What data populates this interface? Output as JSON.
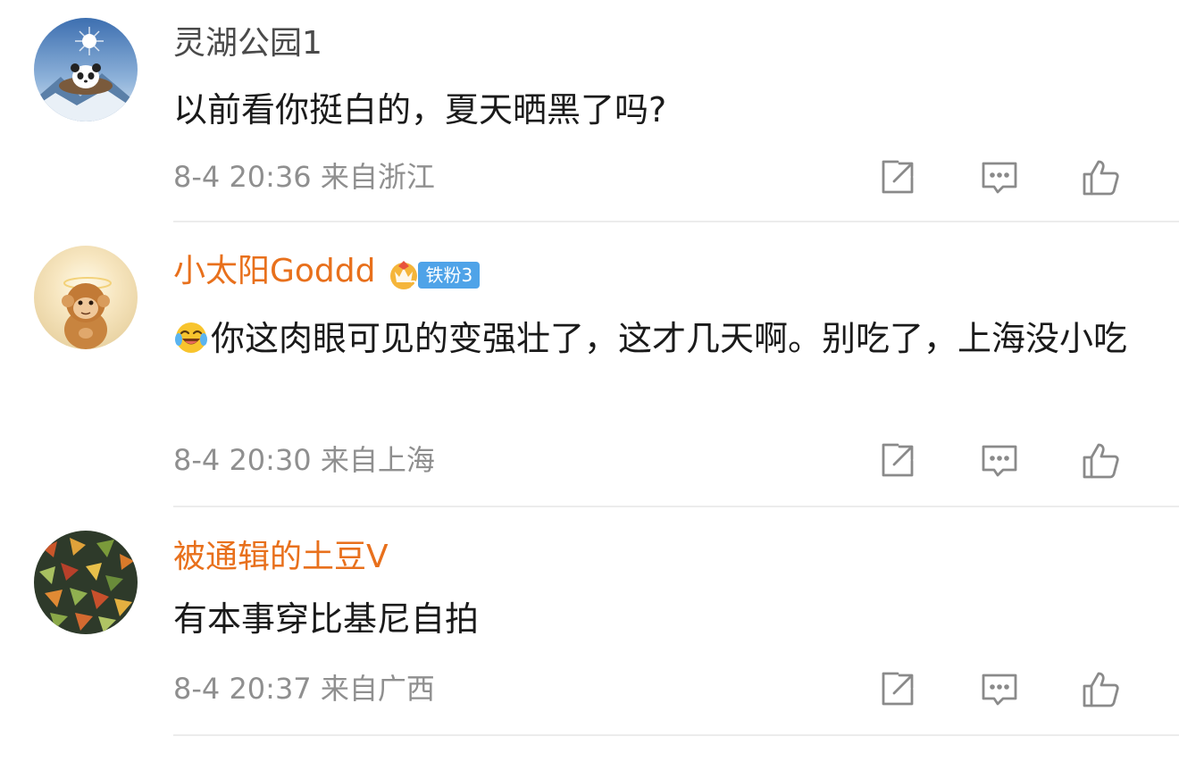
{
  "comments": [
    {
      "username": "灵湖公园1",
      "text": "以前看你挺白的，夏天晒黑了吗?",
      "time": "8-4 20:36",
      "location": "来自浙江"
    },
    {
      "username": "小太阳Goddd",
      "badge": "铁粉3",
      "emoji": "laugh-cry-emoji",
      "text": "你这肉眼可见的变强壮了，这才几天啊。别吃了，上海没小吃",
      "time": "8-4 20:30",
      "location": "来自上海"
    },
    {
      "username": "被通辑的土豆V",
      "text": "有本事穿比基尼自拍",
      "time": "8-4 20:37",
      "location": "来自广西"
    }
  ],
  "icons": {
    "share": "share-icon",
    "comment": "comment-icon",
    "like": "thumbs-up-icon"
  },
  "colors": {
    "vip_name": "#e8701c",
    "plain_name": "#4a4a4a",
    "meta_text": "#8f8f8f",
    "badge_bg": "#4fa3e8",
    "icon": "#8a8a8a"
  }
}
